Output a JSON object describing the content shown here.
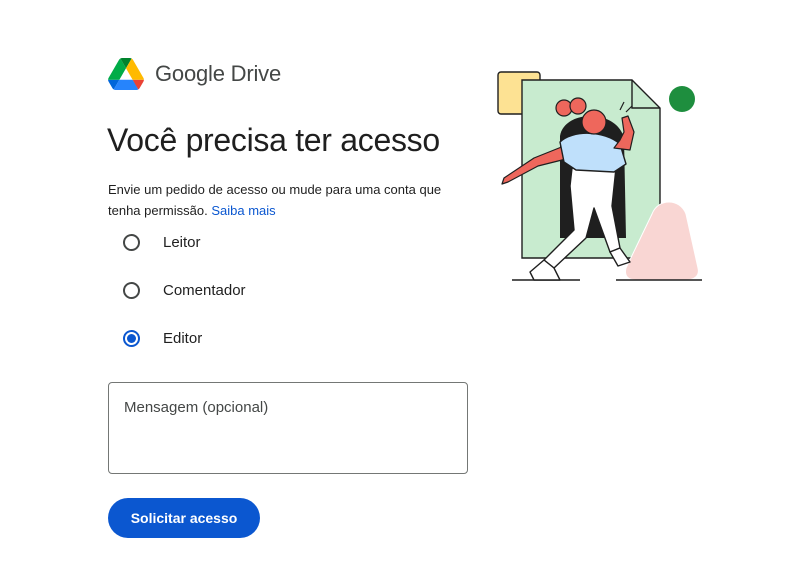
{
  "brand": {
    "logo_icon": "google-drive-logo",
    "name": "Google Drive"
  },
  "page_title": "Você precisa ter acesso",
  "description": {
    "text": "Envie um pedido de acesso ou mude para uma conta que tenha permissão.",
    "link_label": "Saiba mais"
  },
  "access_options": [
    {
      "label": "Leitor",
      "selected": false
    },
    {
      "label": "Comentador",
      "selected": false
    },
    {
      "label": "Editor",
      "selected": true
    }
  ],
  "message": {
    "placeholder": "Mensagem (opcional)",
    "value": ""
  },
  "submit_label": "Solicitar acesso",
  "illustration_icon": "person-walking-through-document-illustration",
  "colors": {
    "accent": "#0b57d0",
    "text": "#1f1f1f",
    "muted": "#444746",
    "document_bg": "#c8ebcf",
    "shirt": "#bfe0fb",
    "skin_hair": "#ee675c",
    "circle_green": "#1e8e3e",
    "square_yellow": "#fde293",
    "shape_pink": "#f9d6d3"
  }
}
